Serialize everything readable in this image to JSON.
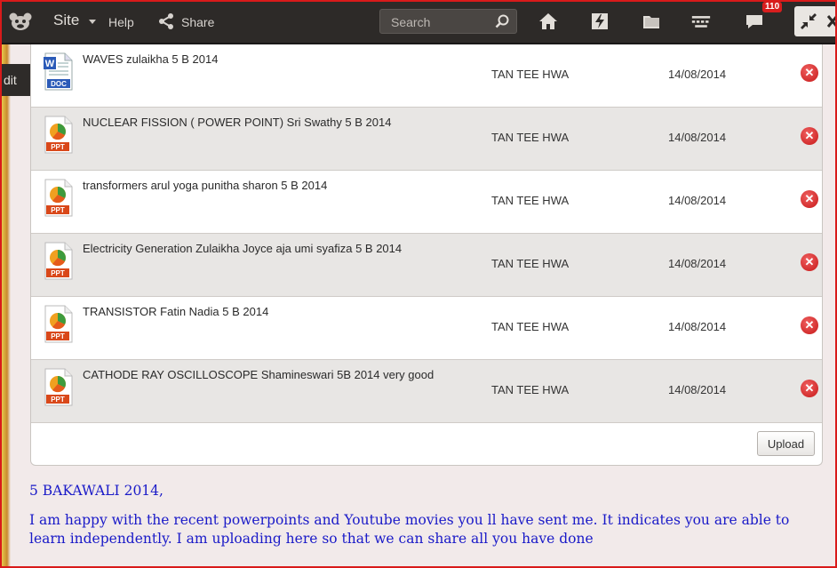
{
  "topbar": {
    "site_label": "Site",
    "help_label": "Help",
    "share_label": "Share",
    "search_placeholder": "Search",
    "notification_count": "110"
  },
  "edit_tab": {
    "label": "dit"
  },
  "files": [
    {
      "type": "doc",
      "name": "WAVES zulaikha 5 B 2014",
      "owner": "TAN TEE HWA",
      "date": "14/08/2014"
    },
    {
      "type": "ppt",
      "name": "NUCLEAR FISSION ( POWER POINT) Sri Swathy 5 B 2014",
      "owner": "TAN TEE HWA",
      "date": "14/08/2014"
    },
    {
      "type": "ppt",
      "name": "transformers arul yoga punitha sharon 5 B 2014",
      "owner": "TAN TEE HWA",
      "date": "14/08/2014"
    },
    {
      "type": "ppt",
      "name": "Electricity Generation Zulaikha Joyce aja umi syafiza 5 B 2014",
      "owner": "TAN TEE HWA",
      "date": "14/08/2014"
    },
    {
      "type": "ppt",
      "name": "TRANSISTOR Fatin Nadia 5 B 2014",
      "owner": "TAN TEE HWA",
      "date": "14/08/2014"
    },
    {
      "type": "ppt",
      "name": "CATHODE RAY OSCILLOSCOPE Shamineswari 5B 2014 very good",
      "owner": "TAN TEE HWA",
      "date": "14/08/2014"
    }
  ],
  "file_icon_labels": {
    "doc": "DOC",
    "ppt": "PPT"
  },
  "upload_label": "Upload",
  "message": {
    "heading": "5 BAKAWALI 2014,",
    "body": "I am happy with the recent powerpoints and Youtube movies you ll have sent me. It indicates you are able to learn independently. I am uploading here so that we can share all you have done"
  },
  "colors": {
    "topbar": "#2d2a28",
    "accent_red": "#d81e1e",
    "message_text": "#1a1ac8",
    "alt_row": "#e8e6e4"
  }
}
